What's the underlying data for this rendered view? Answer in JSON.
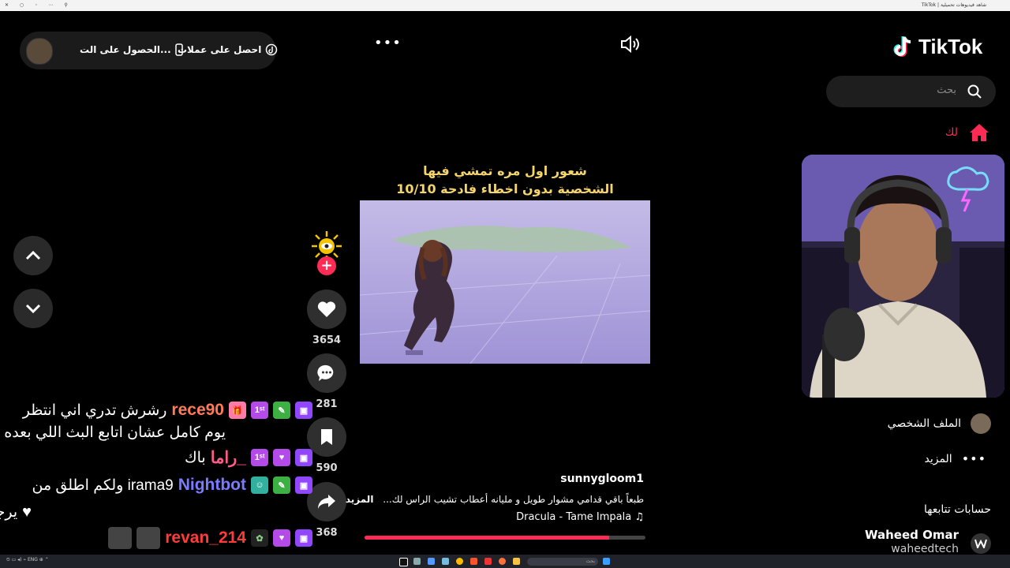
{
  "window": {
    "title": "TikTok | شاهد فيديوهات تحميلية"
  },
  "brand": {
    "name": "TikTok",
    "accent": "#fe2c55"
  },
  "search": {
    "placeholder": "بحث"
  },
  "sidebar": {
    "for_you": "لك",
    "profile": "الملف الشخصي",
    "more": "المزيد",
    "following_title": "حسابات تتابعها",
    "following": [
      {
        "name": "Waheed Omar",
        "handle": "waheedtech"
      }
    ]
  },
  "header": {
    "get_coins": "احصل على عملات",
    "get_app": "الحصول على الت..."
  },
  "video": {
    "overlay_line1": "شعور اول مره تمشي فيها",
    "overlay_line2": "الشخصية بدون اخطاء فادحة 10/10",
    "author": "sunnygloom1",
    "caption": "طبعاً باقي قدامي مشوار طويل و مليانه أعطاب تشيب الراس لك...",
    "more": "المزيد",
    "music": "Dracula - Tame Impala",
    "progress": 0.87
  },
  "actions": {
    "likes": "3654",
    "comments": "281",
    "saves": "590",
    "shares": "368"
  },
  "chat": [
    {
      "user": "rece90",
      "user_color": "#ff7a59",
      "text": "رشرش تدري اني انتظر",
      "text2": "يوم كامل عشان اتابع البث اللي بعده ؟"
    },
    {
      "user": "_راما",
      "user_color": "#ff5a8a",
      "text": "باك"
    },
    {
      "user": "Nightbot",
      "user_color": "#7b7bff",
      "text": "irama9 ولكم اطلق من",
      "text2": "يرجع"
    },
    {
      "user": "revan_214",
      "user_color": "#ff3b3b",
      "text": ""
    }
  ],
  "taskbar": {
    "search_placeholder": "بحث",
    "lang": "ENG"
  }
}
